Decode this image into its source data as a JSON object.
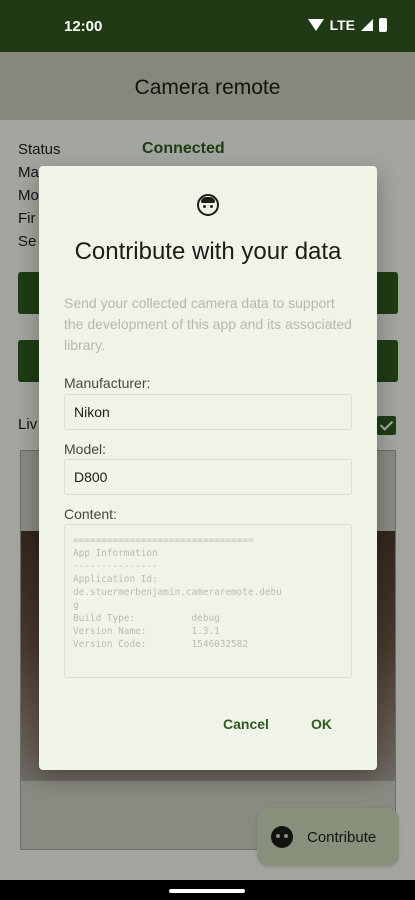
{
  "status_bar": {
    "time": "12:00",
    "network": "LTE"
  },
  "app_bar": {
    "title": "Camera remote"
  },
  "info": {
    "rows": [
      "Status",
      "Ma",
      "Mo",
      "Fir",
      "Se"
    ],
    "status_value": "Connected",
    "status_color": "#2d5a1d"
  },
  "live_view": {
    "label": "Liv",
    "checked": true
  },
  "fab": {
    "label": "Contribute",
    "icon": "contribute-face-icon"
  },
  "dialog": {
    "icon": "face-icon",
    "title": "Contribute with your data",
    "description": "Send your collected camera data to support the development of this app and its associated library.",
    "manufacturer": {
      "label": "Manufacturer:",
      "value": "Nikon"
    },
    "model": {
      "label": "Model:",
      "value": "D800"
    },
    "content": {
      "label": "Content:",
      "text": "================================\nApp Information\n---------------\nApplication Id:\nde.stuermerbenjamin.cameraremote.debu\ng\nBuild Type:          debug\nVersion Name:        1.3.1\nVersion Code:        1546032582"
    },
    "cancel_label": "Cancel",
    "ok_label": "OK"
  },
  "colors": {
    "primary": "#2d5a1d",
    "status_bar": "#1f3a14",
    "app_bar": "#c3cbb6",
    "dialog_surface": "#f0f4e8",
    "fab": "#c8d4b5"
  }
}
